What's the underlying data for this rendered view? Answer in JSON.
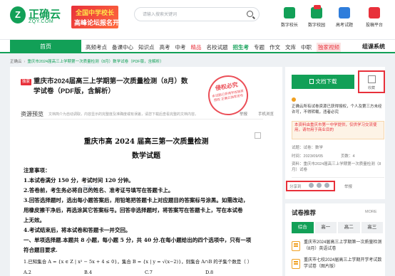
{
  "header": {
    "logo_mark": "Z",
    "logo_cn": "正确云",
    "logo_en": "ZQY.COM",
    "banner_line1": "全国中学校长",
    "banner_line2": "高峰论坛报名开启",
    "search_placeholder": "请输入搜索关键词",
    "tools": [
      {
        "label": "数字校长",
        "color": "#12a057"
      },
      {
        "label": "数字校园",
        "color": "#12a057"
      },
      {
        "label": "高考试题",
        "color": "#2f7ddb"
      },
      {
        "label": "投稿平台",
        "color": "#e8303a"
      }
    ]
  },
  "nav": {
    "home": "首页",
    "items": [
      "高频考点",
      "备课中心",
      "知识点",
      "高考",
      "中考",
      "精品",
      "名校试题",
      "招生考",
      "专题",
      "作文",
      "文库",
      "中职",
      "独家视频"
    ],
    "special": "组课系统"
  },
  "breadcrumb": {
    "root": "正确云",
    "current": "重庆市2024届高三上学期第一次质量检测（8月）数学试卷（PDF版，含解析）"
  },
  "document": {
    "tag": "独家",
    "title": "重庆市2024届高三上学期第一次质量检测（8月）数学试卷（PDF版，含解析）",
    "stamp_title": "侵权必究",
    "stamp_text": "本试题已获得学校独家授权 正确云独家发布",
    "preview_label": "资源预览",
    "preview_note": "文档简介为自动调取，内容显示的完整度及准确度或有误差，请您下载后查看完整的文档内容。",
    "report": "举报",
    "mobile": "手机浏览",
    "watermark": "正确云",
    "paper_title": "重庆市高 2024 届高三第一次质量检测",
    "paper_subtitle": "数学试题",
    "lines": [
      "注意事项：",
      "1.本试卷满分 150 分，考试时间 120 分钟。",
      "2.答卷前，考生务必将自己的姓名、准考证号填写在答题卡上。",
      "3.回答选择题时，选出每小题答案后，用铅笔把答题卡上对应题目的答案标号涂黑。如需改动，",
      "用橡皮擦干净后，再选涂其它答案标号。回答非选择题时，将答案写在答题卡上，写在本试卷",
      "上无效。",
      "4.考试结束后，将本试卷和答题卡一并交回。",
      "一、单项选择题.本题共 8 小题，每小题 5 分，共 40 分.在每小题给出的四个选项中，只有一项",
      "符合题目要求.",
      "1.已知集合 A = {x ∈ Z | x² − 5x + 4 ≤ 0}，集合 B = {x | y = √(x−2)}，则集合 A∩B 的子集个数是（     ）"
    ],
    "choices": [
      "A.2",
      "B.4",
      "C.7",
      "D.8"
    ]
  },
  "sidebar": {
    "download": "文档下载",
    "favorite": "收藏",
    "tip": "正确云所有试卷资源已获得授权，个人及第三方未经许可，不得转载，违者必究",
    "notice": "本资料由重庆市第一中学提供，仅供学习交流使用，请勿用于商业目的",
    "meta": [
      {
        "k": "试题",
        "v": "试卷：数学"
      },
      {
        "k": "时间",
        "v": "2023/09/05",
        "k2": "页数",
        "v2": "4"
      },
      {
        "k": "资料",
        "v": "重庆市2024届高三上学期第一次质量检测（8月）试卷"
      }
    ],
    "share": "分享到",
    "report": "举报"
  },
  "recommend": {
    "title": "试卷推荐",
    "more": "MORE",
    "tabs": [
      "综合",
      "高一",
      "高二",
      "高三"
    ],
    "items": [
      "重庆市2024届高三上学期第一次质量检测（8月）英语试卷",
      "重庆市七校2024届高三上学期开学考试数学试卷（图片版）"
    ]
  }
}
